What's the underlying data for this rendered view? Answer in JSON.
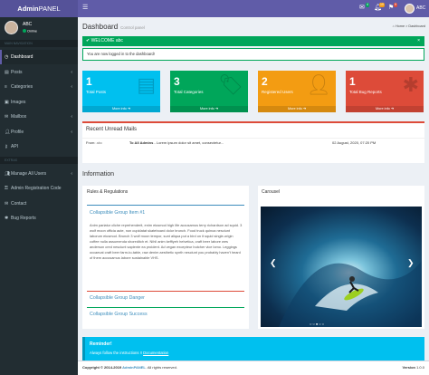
{
  "app": {
    "logo_bold": "Admin",
    "logo_rest": "PANEL",
    "menu_icon": "hamburger-icon"
  },
  "topbar": {
    "mail_badge": "4",
    "bell_badge": "10",
    "flag_badge": "9",
    "user": "ABC",
    "icons": [
      "envelope-icon",
      "bell-icon",
      "flag-icon"
    ]
  },
  "sidebar": {
    "user_name": "ABC",
    "status": "Online",
    "headers": [
      "MAIN NAVIGATION",
      "EXTRAS"
    ],
    "items": [
      {
        "label": "Dashboard",
        "icon": "dashboard-icon",
        "active": true
      },
      {
        "label": "Posts",
        "icon": "document-icon",
        "chevron": true
      },
      {
        "label": "Categories",
        "icon": "list-icon",
        "chevron": true
      },
      {
        "label": "Images",
        "icon": "image-icon"
      },
      {
        "label": "Mailbox",
        "icon": "mail-icon",
        "chevron": true
      },
      {
        "label": "Profile",
        "icon": "user-icon",
        "chevron": true
      },
      {
        "label": "API",
        "icon": "key-icon"
      },
      {
        "label": "Manage All Users",
        "icon": "users-icon",
        "chevron": true
      },
      {
        "label": "Admin Registration Code",
        "icon": "code-icon"
      },
      {
        "label": "Contact",
        "icon": "envelope-icon"
      },
      {
        "label": "Bug Reports",
        "icon": "bug-icon"
      }
    ]
  },
  "page": {
    "title": "Dashboard",
    "subtitle": "Control panel",
    "breadcrumb_home": "Home",
    "breadcrumb_sep": ">",
    "breadcrumb_current": "Dashboard"
  },
  "alert": {
    "welcome": "WELCOME abc",
    "close": "×",
    "message": "You are now logged in to the dashboard!"
  },
  "stats": [
    {
      "value": "1",
      "label": "Total Posts",
      "footer": "More info ➔",
      "color": "#00c0ef",
      "icon": "document-icon"
    },
    {
      "value": "3",
      "label": "Total Categories",
      "footer": "More info ➔",
      "color": "#00a65a",
      "icon": "tag-icon"
    },
    {
      "value": "2",
      "label": "Registered Users",
      "footer": "More info ➔",
      "color": "#f39c12",
      "icon": "user-plus-icon"
    },
    {
      "value": "1",
      "label": "Total Bug Reports",
      "footer": "More info ➔",
      "color": "#dd4b39",
      "icon": "bug-icon"
    }
  ],
  "mails": {
    "title": "Recent Unread Mails",
    "from_label": "From:",
    "from_value": "abc",
    "to_label": "To All Admins",
    "preview": "- Lorem ipsum dolor sit amet, consectetur...",
    "date": "02 August, 2020, 07:20 PM"
  },
  "information": {
    "title": "Information"
  },
  "rules": {
    "title": "Rules & Regulations",
    "groups": [
      "Collapsible Group Item #1",
      "Collapsible Group Danger",
      "Collapsible Group Success"
    ],
    "text": "Anim pariatur cliche reprehenderit, enim eiusmod high life accusamus terry richardson ad squid. 3 wolf moon officia aute, non cupidatat skateboard dolor brunch. Food truck quinoa nesciunt laborum eiusmod. Brunch 3 wolf moon tempor, sunt aliqua put a bird on it squid single-origin coffee nulla assumenda shoreditch et. Nihil anim keffiyeh helvetica, craft beer labore wes anderson cred nesciunt sapiente ea proident. Ad vegan excepteur butcher vice lomo. Leggings occaecat craft beer farm-to-table, raw denim aesthetic synth nesciunt you probably haven't heard of them accusamus labore sustainable VHS."
  },
  "carousel": {
    "title": "Carousel",
    "prev": "❮",
    "next": "❯",
    "dots": "○○●○○"
  },
  "reminder": {
    "title": "Reminder!",
    "text": "Always follow the instructions !!",
    "link": "Documentation"
  },
  "footer": {
    "copyright": "Copyright © 2014-2019 ",
    "brand": "AdminPANEL",
    "rights": ". All rights reserved.",
    "version_label": "Version",
    "version": "1.0.0"
  }
}
